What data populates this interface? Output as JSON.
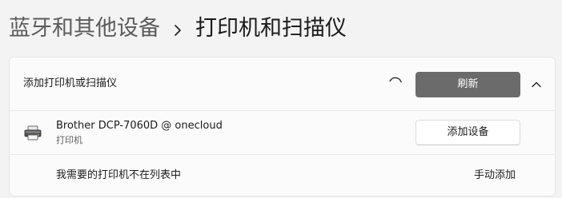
{
  "breadcrumb": {
    "parent": "蓝牙和其他设备",
    "separator_icon": "chevron-right-icon",
    "current": "打印机和扫描仪"
  },
  "add_section": {
    "label": "添加打印机或扫描仪",
    "status_icon": "spinner-icon",
    "refresh_label": "刷新",
    "collapse_icon": "chevron-up-icon"
  },
  "device": {
    "icon": "printer-icon",
    "name": "Brother DCP-7060D @ onecloud",
    "type": "打印机",
    "add_button_label": "添加设备"
  },
  "manual": {
    "label": "我需要的打印机不在列表中",
    "link_label": "手动添加"
  },
  "colors": {
    "page_background": "#f3f3f3",
    "panel_background": "#fbfbfb",
    "refresh_button_background": "#6b6b6b",
    "refresh_button_text": "#ffffff"
  }
}
